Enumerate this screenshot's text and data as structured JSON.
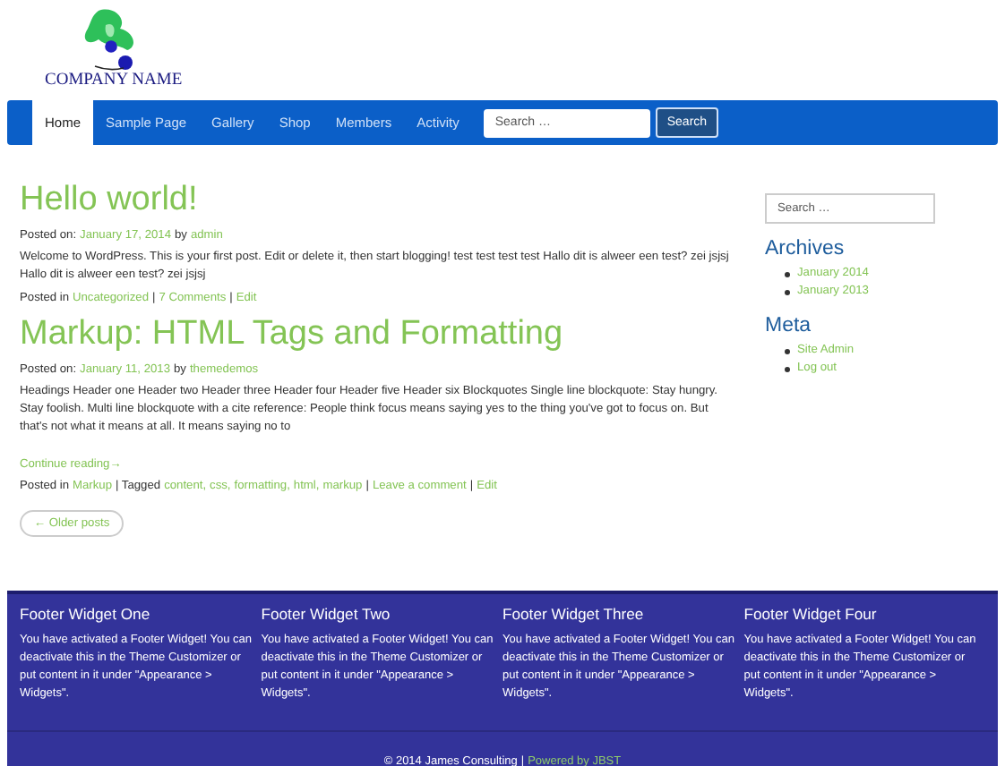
{
  "header": {
    "company_name": "COMPANY NAME"
  },
  "nav": {
    "items": [
      {
        "label": "Home",
        "selected": true
      },
      {
        "label": "Sample Page",
        "selected": false
      },
      {
        "label": "Gallery",
        "selected": false
      },
      {
        "label": "Shop",
        "selected": false
      },
      {
        "label": "Members",
        "selected": false
      },
      {
        "label": "Activity",
        "selected": false
      }
    ],
    "search": {
      "placeholder": "Search …",
      "button": "Search"
    }
  },
  "posts": [
    {
      "title": "Hello world!",
      "meta": [
        {
          "kind": "text",
          "text": "Posted on:"
        },
        {
          "kind": "link",
          "text": "January 17, 2014"
        },
        {
          "kind": "text",
          "text": "by"
        },
        {
          "kind": "link",
          "text": "admin"
        }
      ],
      "body": "Welcome to WordPress. This is your first post. Edit or delete it, then start blogging! test test test test Hallo dit is alweer een test? zei jsjsj Hallo dit is alweer een test? zei jsjsj",
      "footer": [
        {
          "kind": "text",
          "text": "Posted in"
        },
        {
          "kind": "link",
          "text": "Uncategorized"
        },
        {
          "kind": "text",
          "text": "|"
        },
        {
          "kind": "link",
          "text": "7 Comments"
        },
        {
          "kind": "text",
          "text": "|"
        },
        {
          "kind": "link",
          "text": "Edit"
        }
      ]
    },
    {
      "title": "Markup: HTML Tags and Formatting",
      "meta": [
        {
          "kind": "text",
          "text": "Posted on:"
        },
        {
          "kind": "link",
          "text": "January 11, 2013"
        },
        {
          "kind": "text",
          "text": "by"
        },
        {
          "kind": "link",
          "text": "themedemos"
        }
      ],
      "body": "Headings Header one Header two Header three Header four Header five Header six Blockquotes Single line blockquote: Stay hungry. Stay foolish. Multi line blockquote with a cite reference: People think focus means saying yes to the thing you've got to focus on. But that's not what it means at all. It means saying no to",
      "more": "Continue reading→",
      "footer": [
        {
          "kind": "text",
          "text": "Posted in"
        },
        {
          "kind": "link",
          "text": "Markup"
        },
        {
          "kind": "text",
          "text": "| Tagged"
        },
        {
          "kind": "link",
          "text": "content,"
        },
        {
          "kind": "link",
          "text": "css,"
        },
        {
          "kind": "link",
          "text": "formatting,"
        },
        {
          "kind": "link",
          "text": "html,"
        },
        {
          "kind": "link",
          "text": "markup"
        },
        {
          "kind": "text",
          "text": "|"
        },
        {
          "kind": "link",
          "text": "Leave a comment"
        },
        {
          "kind": "text",
          "text": "|"
        },
        {
          "kind": "link",
          "text": "Edit"
        }
      ]
    }
  ],
  "older_posts": "← Older posts",
  "sidebar": {
    "search": {
      "placeholder": "Search …"
    },
    "widgets": [
      {
        "title": "Archives",
        "items": [
          "January 2014",
          "January 2013"
        ]
      },
      {
        "title": "Meta",
        "items": [
          "Site Admin",
          "Log out"
        ]
      }
    ]
  },
  "footer": {
    "widgets": [
      {
        "title": "Footer Widget One",
        "text": "You have activated a Footer Widget! You can deactivate this in the Theme Customizer or put content in it under \"Appearance > Widgets\"."
      },
      {
        "title": "Footer Widget Two",
        "text": "You have activated a Footer Widget! You can deactivate this in the Theme Customizer or put content in it under \"Appearance > Widgets\"."
      },
      {
        "title": "Footer Widget Three",
        "text": "You have activated a Footer Widget! You can deactivate this in the Theme Customizer or put content in it under \"Appearance > Widgets\"."
      },
      {
        "title": "Footer Widget Four",
        "text": "You have activated a Footer Widget! You can deactivate this in the Theme Customizer or put content in it under \"Appearance > Widgets\"."
      }
    ],
    "credit": [
      {
        "kind": "text",
        "text": "© 2014 James Consulting"
      },
      {
        "kind": "text",
        "text": "|"
      },
      {
        "kind": "link",
        "text": "Powered by JBST"
      }
    ]
  }
}
